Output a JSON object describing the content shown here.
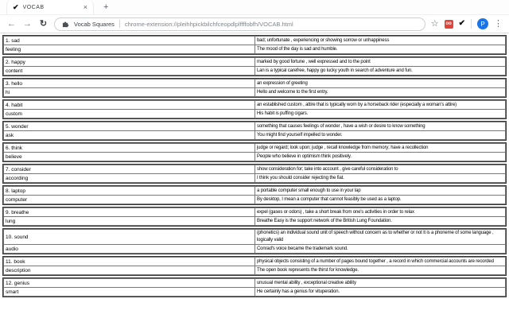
{
  "browser": {
    "tab_title": "VOCAB",
    "favicon_glyph": "✔",
    "close_tab_glyph": "×",
    "new_tab_glyph": "+",
    "back_glyph": "←",
    "forward_glyph": "→",
    "reload_glyph": "↻",
    "site_label": "Vocab Squares",
    "url": "chrome-extension://pleihhpickbilchfceopdlplffffobfh/VOCAB.html",
    "bookmark_glyph": "☆",
    "extension_red_badge": "oo",
    "extension_check_glyph": "✔",
    "profile_initial": "P",
    "menu_glyph": "⋮"
  },
  "colors": {
    "accent_red": "#e2443b",
    "profile_blue": "#1a73e8",
    "table_outer_border": "#383838",
    "table_inner_border": "#777777",
    "text": "#000000"
  },
  "vocab": {
    "entries": [
      {
        "term": "1. sad",
        "alt": "feeling",
        "definition": "bad; unfortunate , experiencing or showing sorrow or unhappiness",
        "example": "The mood of the day is sad and humble."
      },
      {
        "term": "2. happy",
        "alt": "content",
        "definition": "marked by good fortune , well expressed and to the point",
        "example": "Lan is a typical carefree, happy go lucky youth in search of adventure and fun."
      },
      {
        "term": "3. hello",
        "alt": "hi",
        "definition": "an expression of greeting",
        "example": "Hello and welcome to the first entry."
      },
      {
        "term": "4. habit",
        "alt": "custom",
        "definition": "an established custom , attire that is typically worn by a horseback rider (especially a woman's attire)",
        "example": "His habit is puffing cigars."
      },
      {
        "term": "5. wonder",
        "alt": "ask",
        "definition": "something that causes feelings of wonder , have a wish or desire to know something",
        "example": "You might find yourself impelled to wonder."
      },
      {
        "term": "6. think",
        "alt": "believe",
        "definition": "judge or regard; look upon; judge , recall knowledge from memory; have a recollection",
        "example": "People who believe in optimism think positively."
      },
      {
        "term": "7. consider",
        "alt": "according",
        "definition": "show consideration for; take into account , give careful consideration to",
        "example": "I think you should consider rejecting the fiat."
      },
      {
        "term": "8. laptop",
        "alt": "computer",
        "definition": "a portable computer small enough to use in your lap",
        "example": "By desktop, I mean a computer that cannot feasibly be used as a laptop."
      },
      {
        "term": "9. breathe",
        "alt": "lung",
        "definition": "expel (gases or odors) , take a short break from one's activities in order to relax",
        "example": "Breathe Easy is the support network of the British Lung Foundation."
      },
      {
        "term": "10. sound",
        "alt": "audio",
        "definition": "(phonetics) an individual sound unit of speech without concern as to whether or not it is a phoneme of some language , logically valid",
        "example": "Conrad's voice became the trademark sound."
      },
      {
        "term": "11. book",
        "alt": "description",
        "definition": "physical objects consisting of a number of pages bound together , a record in which commercial accounts are recorded",
        "example": "The open book represents the thirst for knowledge."
      },
      {
        "term": "12. genius",
        "alt": "smart",
        "definition": "unusual mental ability , exceptional creative ability",
        "example": "He certainly has a genius for vituperation."
      }
    ]
  }
}
